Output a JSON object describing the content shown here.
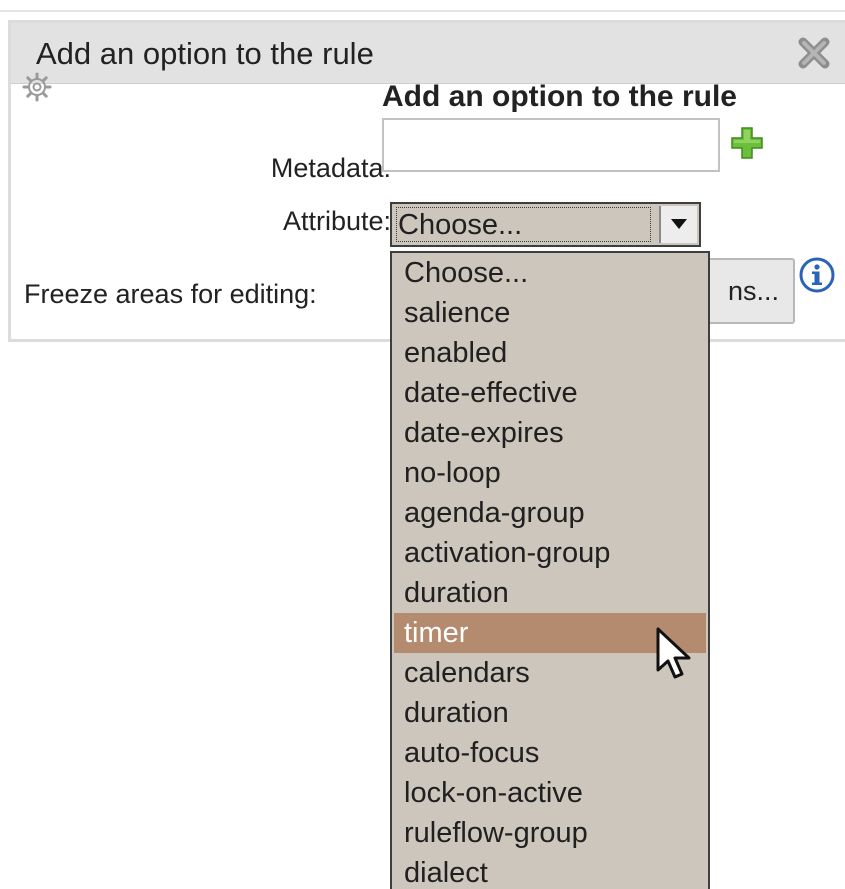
{
  "dialog": {
    "title": "Add an option to the rule",
    "form_heading": "Add an option to the rule",
    "icons": {
      "close": "close-icon",
      "gear": "gear-icon",
      "add": "plus-icon",
      "info": "info-icon"
    }
  },
  "form": {
    "metadata_label": "Metadata:",
    "metadata_value": "",
    "attribute_label": "Attribute:",
    "attribute_selected": "Choose...",
    "freeze_label": "Freeze areas for editing:",
    "freeze_button_label": "ns..."
  },
  "dropdown": {
    "highlighted": "timer",
    "options": [
      "Choose...",
      "salience",
      "enabled",
      "date-effective",
      "date-expires",
      "no-loop",
      "agenda-group",
      "activation-group",
      "duration",
      "timer",
      "calendars",
      "duration",
      "auto-focus",
      "lock-on-active",
      "ruleflow-group",
      "dialect"
    ]
  },
  "colors": {
    "header_bg": "#e2e2e2",
    "select_bg": "#cdc6bd",
    "highlight_bg": "#b48b6f",
    "plus_green": "#6cbf3a",
    "info_blue": "#2a63b7"
  }
}
